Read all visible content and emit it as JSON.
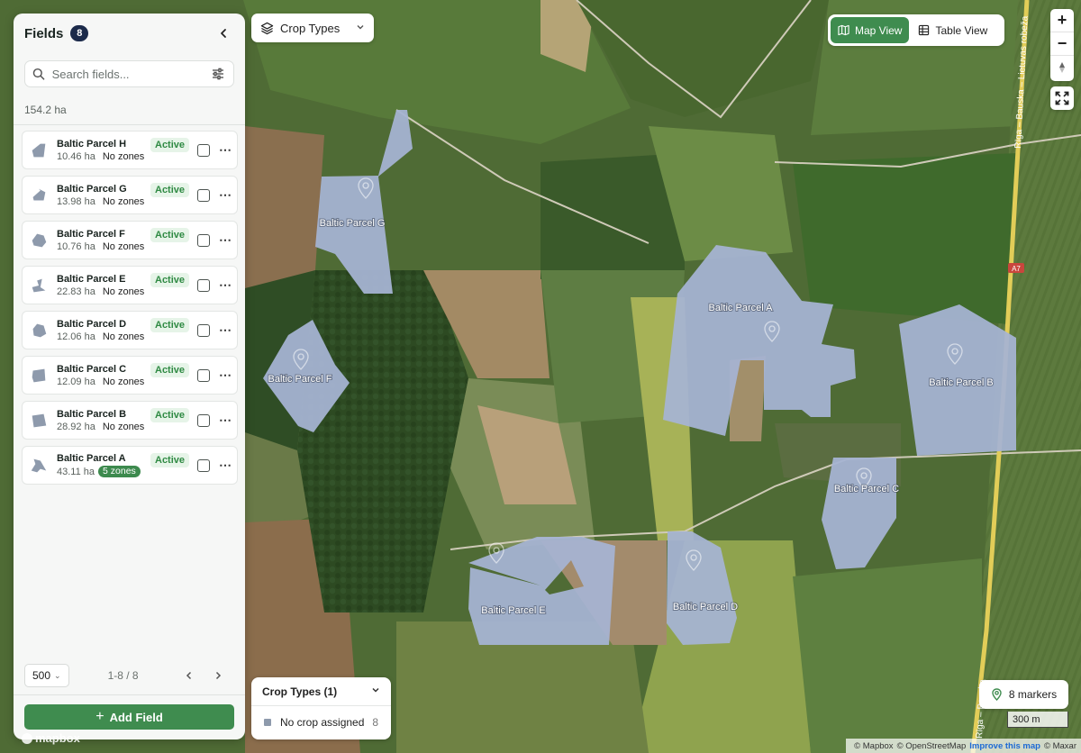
{
  "sidebar": {
    "title": "Fields",
    "count": "8",
    "search_placeholder": "Search fields...",
    "total_area": "154.2 ha",
    "fields": [
      {
        "name": "Baltic Parcel H",
        "area": "10.46 ha",
        "zones": "No zones",
        "status": "Active",
        "has_zone_pill": false
      },
      {
        "name": "Baltic Parcel G",
        "area": "13.98 ha",
        "zones": "No zones",
        "status": "Active",
        "has_zone_pill": false
      },
      {
        "name": "Baltic Parcel F",
        "area": "10.76 ha",
        "zones": "No zones",
        "status": "Active",
        "has_zone_pill": false
      },
      {
        "name": "Baltic Parcel E",
        "area": "22.83 ha",
        "zones": "No zones",
        "status": "Active",
        "has_zone_pill": false
      },
      {
        "name": "Baltic Parcel D",
        "area": "12.06 ha",
        "zones": "No zones",
        "status": "Active",
        "has_zone_pill": false
      },
      {
        "name": "Baltic Parcel C",
        "area": "12.09 ha",
        "zones": "No zones",
        "status": "Active",
        "has_zone_pill": false
      },
      {
        "name": "Baltic Parcel B",
        "area": "28.92 ha",
        "zones": "No zones",
        "status": "Active",
        "has_zone_pill": false
      },
      {
        "name": "Baltic Parcel A",
        "area": "43.11 ha",
        "zones": "5 zones",
        "status": "Active",
        "has_zone_pill": true
      }
    ],
    "page_size": "500",
    "page_range": "1-8 / 8",
    "add_field_label": "Add Field"
  },
  "crop_dropdown": {
    "label": "Crop Types"
  },
  "view_toggle": {
    "map_label": "Map View",
    "table_label": "Table View",
    "active": "map"
  },
  "zoom": {
    "in_label": "+",
    "out_label": "−",
    "compass": "▲"
  },
  "legend": {
    "title": "Crop Types (1)",
    "rows": [
      {
        "name": "No crop assigned",
        "count": "8",
        "color": "#8e9aac"
      }
    ]
  },
  "map": {
    "parcel_labels": {
      "A": "Baltic Parcel A",
      "B": "Baltic Parcel B",
      "C": "Baltic Parcel C",
      "D": "Baltic Parcel D",
      "E": "Baltic Parcel E",
      "F": "Baltic Parcel F",
      "G": "Baltic Parcel G"
    },
    "road_labels": {
      "main": "Rīga – Bauska – Lietuvas robeža",
      "main_short": "Rīga – Bauska",
      "route": "A7"
    },
    "parcel_color": "#a6b4d2"
  },
  "markers": {
    "label": "8 markers"
  },
  "scale": {
    "label": "300 m"
  },
  "attribution": {
    "mapbox": "© Mapbox",
    "osm": "© OpenStreetMap",
    "improve": "Improve this map",
    "maxar": "© Maxar"
  },
  "logo": "mapbox",
  "colors": {
    "accent": "#3f8c4f",
    "badge_dark": "#1b2a4a",
    "active_text": "#2f8a43"
  }
}
